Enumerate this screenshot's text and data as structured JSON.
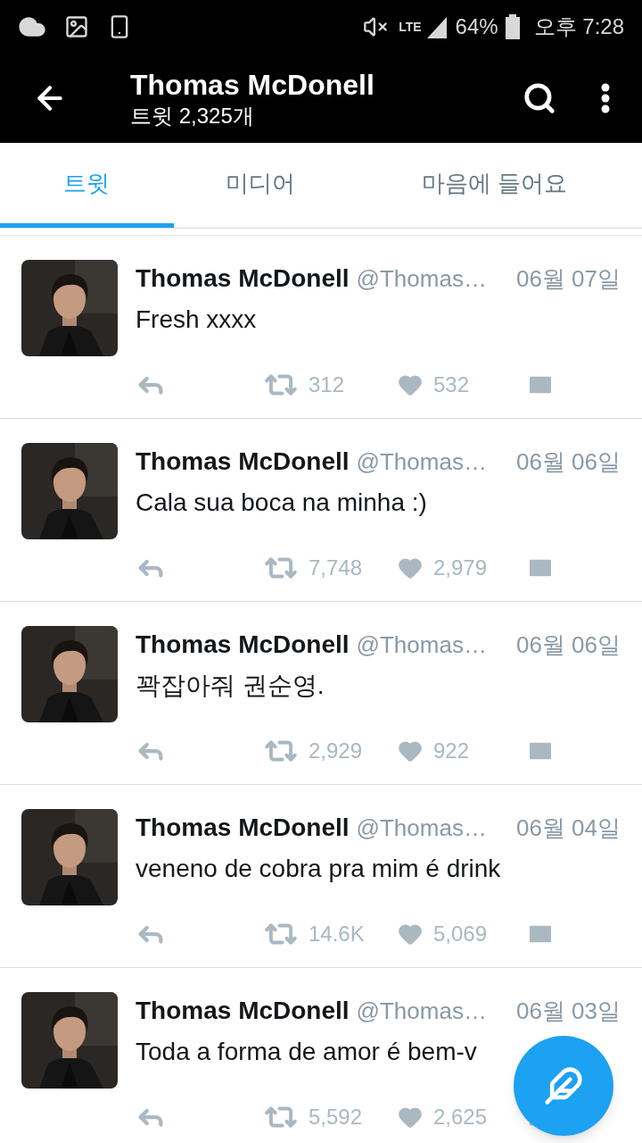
{
  "status_bar": {
    "network": "LTE",
    "battery": "64%",
    "time": "오후 7:28"
  },
  "header": {
    "title": "Thomas McDonell",
    "subtitle": "트윗 2,325개"
  },
  "tabs": [
    {
      "label": "트윗",
      "selected": true
    },
    {
      "label": "미디어",
      "selected": false
    },
    {
      "label": "마음에 들어요",
      "selected": false
    }
  ],
  "tweets": [
    {
      "name": "Thomas McDonell",
      "handle": "@Thomas…",
      "date": "06월 07일",
      "text": "Fresh xxxx",
      "retweets": "312",
      "likes": "532"
    },
    {
      "name": "Thomas McDonell",
      "handle": "@Thomas…",
      "date": "06월 06일",
      "text": "Cala sua boca na minha :)",
      "retweets": "7,748",
      "likes": "2,979"
    },
    {
      "name": "Thomas McDonell",
      "handle": "@Thomas…",
      "date": "06월 06일",
      "text": "꽉잡아줘 권순영.",
      "retweets": "2,929",
      "likes": "922"
    },
    {
      "name": "Thomas McDonell",
      "handle": "@Thomas…",
      "date": "06월 04일",
      "text": "veneno de cobra pra mim é drink",
      "retweets": "14.6K",
      "likes": "5,069"
    },
    {
      "name": "Thomas McDonell",
      "handle": "@Thomas…",
      "date": "06월 03일",
      "text": "Toda a forma de amor é bem-v",
      "retweets": "5,592",
      "likes": "2,625"
    }
  ]
}
